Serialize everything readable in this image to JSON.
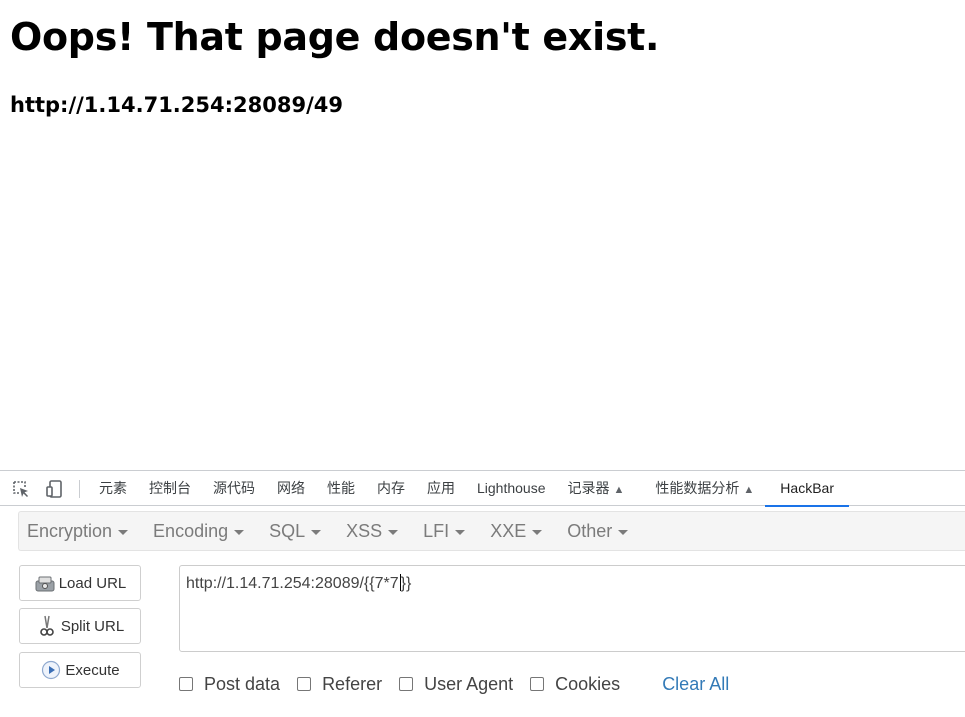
{
  "page": {
    "heading": "Oops! That page doesn't exist.",
    "url_text": "http://1.14.71.254:28089/49"
  },
  "devtools": {
    "tools": [
      {
        "icon": "inspect-element-icon"
      },
      {
        "icon": "device-toolbar-icon"
      }
    ],
    "tabs": [
      {
        "label": "元素"
      },
      {
        "label": "控制台"
      },
      {
        "label": "源代码"
      },
      {
        "label": "网络"
      },
      {
        "label": "性能"
      },
      {
        "label": "内存"
      },
      {
        "label": "应用"
      },
      {
        "label": "Lighthouse"
      },
      {
        "label": "记录器",
        "experimental": true
      },
      {
        "label": "性能数据分析",
        "experimental": true
      },
      {
        "label": "HackBar",
        "active": true
      }
    ]
  },
  "hackbar": {
    "menus": [
      "Encryption",
      "Encoding",
      "SQL",
      "XSS",
      "LFI",
      "XXE",
      "Other"
    ],
    "buttons": {
      "load_url": "Load URL",
      "split_url": "Split URL",
      "execute": "Execute"
    },
    "url_value": "http://1.14.71.254:28089/{{7*7}}",
    "url_before_caret": "http://1.14.71.254:28089/{{7*7",
    "url_after_caret": "}}",
    "options": [
      {
        "label": "Post data",
        "checked": false
      },
      {
        "label": "Referer",
        "checked": false
      },
      {
        "label": "User Agent",
        "checked": false
      },
      {
        "label": "Cookies",
        "checked": false
      }
    ],
    "clear_all": "Clear All"
  },
  "colors": {
    "active_tab_underline": "#1a73e8",
    "link": "#337ab7",
    "menu_text": "#7b7b7b"
  }
}
